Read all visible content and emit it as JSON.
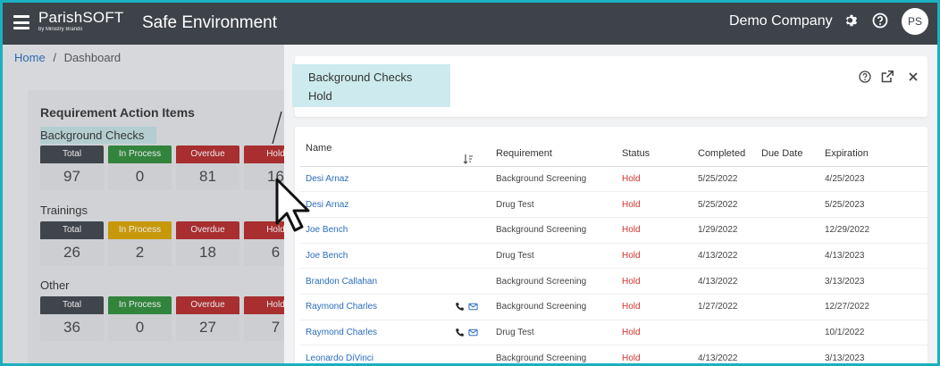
{
  "topbar": {
    "logo_main": "ParishSOFT",
    "logo_sub": "by Ministry Brands",
    "app_title": "Safe Environment",
    "company": "Demo Company",
    "avatar_initials": "PS"
  },
  "breadcrumb": {
    "home": "Home",
    "sep": "/",
    "current": "Dashboard"
  },
  "dashboard": {
    "title": "Requirement Action Items",
    "sections": [
      {
        "label": "Background Checks",
        "tiles": [
          {
            "label": "Total",
            "value": "97",
            "color": "#3e4349"
          },
          {
            "label": "In Process",
            "value": "0",
            "color": "#2e8b3a"
          },
          {
            "label": "Overdue",
            "value": "81",
            "color": "#b42a2a"
          },
          {
            "label": "Hold",
            "value": "16",
            "color": "#b42a2a"
          }
        ]
      },
      {
        "label": "Trainings",
        "tiles": [
          {
            "label": "Total",
            "value": "26",
            "color": "#3e4349"
          },
          {
            "label": "In Process",
            "value": "2",
            "color": "#d9a200"
          },
          {
            "label": "Overdue",
            "value": "18",
            "color": "#b42a2a"
          },
          {
            "label": "Hold",
            "value": "6",
            "color": "#b42a2a"
          }
        ]
      },
      {
        "label": "Other",
        "tiles": [
          {
            "label": "Total",
            "value": "36",
            "color": "#3e4349"
          },
          {
            "label": "In Process",
            "value": "0",
            "color": "#2e8b3a"
          },
          {
            "label": "Overdue",
            "value": "27",
            "color": "#b42a2a"
          },
          {
            "label": "Hold",
            "value": "7",
            "color": "#b42a2a"
          }
        ]
      }
    ]
  },
  "panel": {
    "title_line1": "Background Checks",
    "title_line2": "Hold",
    "columns": [
      "Name",
      "Requirement",
      "Status",
      "Completed",
      "Due Date",
      "Expiration"
    ],
    "rows": [
      {
        "name": "Desi Arnaz",
        "contact": false,
        "requirement": "Background Screening",
        "status": "Hold",
        "completed": "5/25/2022",
        "due": "",
        "expiration": "4/25/2023"
      },
      {
        "name": "Desi Arnaz",
        "contact": false,
        "requirement": "Drug Test",
        "status": "Hold",
        "completed": "5/25/2022",
        "due": "",
        "expiration": "5/25/2023"
      },
      {
        "name": "Joe Bench",
        "contact": false,
        "requirement": "Background Screening",
        "status": "Hold",
        "completed": "1/29/2022",
        "due": "",
        "expiration": "12/29/2022"
      },
      {
        "name": "Joe Bench",
        "contact": false,
        "requirement": "Drug Test",
        "status": "Hold",
        "completed": "4/13/2022",
        "due": "",
        "expiration": "4/13/2023"
      },
      {
        "name": "Brandon Callahan",
        "contact": false,
        "requirement": "Background Screening",
        "status": "Hold",
        "completed": "4/13/2022",
        "due": "",
        "expiration": "3/13/2023"
      },
      {
        "name": "Raymond Charles",
        "contact": true,
        "requirement": "Background Screening",
        "status": "Hold",
        "completed": "1/27/2022",
        "due": "",
        "expiration": "12/27/2022"
      },
      {
        "name": "Raymond Charles",
        "contact": true,
        "requirement": "Drug Test",
        "status": "Hold",
        "completed": "",
        "due": "",
        "expiration": "10/1/2022"
      },
      {
        "name": "Leonardo DiVinci",
        "contact": false,
        "requirement": "Background Screening",
        "status": "Hold",
        "completed": "4/13/2022",
        "due": "",
        "expiration": "3/13/2023"
      }
    ]
  }
}
